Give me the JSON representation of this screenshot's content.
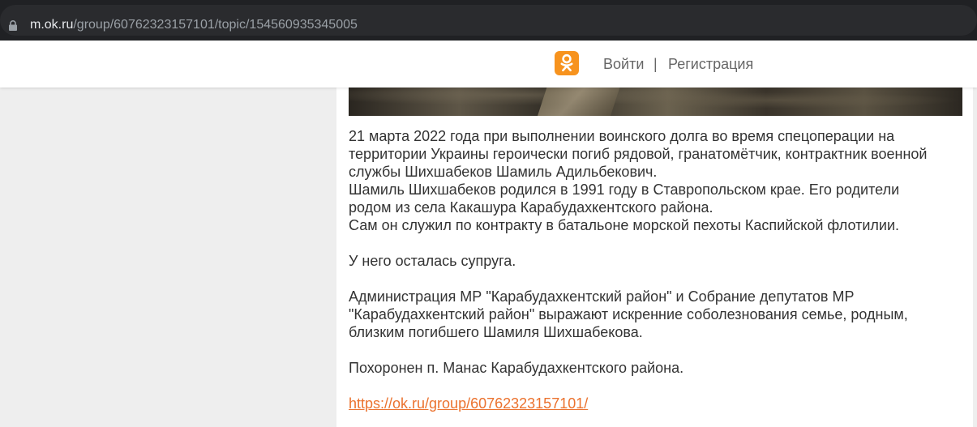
{
  "browser": {
    "url_domain": "m.ok.ru",
    "url_path": "/group/60762323157101/topic/154560935345005"
  },
  "header": {
    "login_label": "Войти",
    "separator": "|",
    "register_label": "Регистрация",
    "logo_icon": "odnoklassniki-logo-icon",
    "brand_color": "#f7931e"
  },
  "article": {
    "lines": [
      "21 марта 2022 года при выполнении воинского долга во время спецоперации на",
      "территории Украины героически погиб рядовой, гранатомётчик, контрактник военной",
      "службы Шихшабеков Шамиль Адильбекович.",
      "Шамиль Шихшабеков родился в 1991 году в Ставропольском крае. Его родители",
      "родом из села Какашура Карабудахкентского района.",
      "Сам он служил по контракту в батальоне морской пехоты Каспийской флотилии.",
      "",
      "У него осталась супруга.",
      "",
      "Администрация МР \"Карабудахкентский район\" и Собрание депутатов МР",
      "\"Карабудахкентский район\" выражают искренние соболезнования семье, родным,",
      "близким погибшего Шамиля Шихшабекова.",
      "",
      "Похоронен п. Манас Карабудахкентского района.",
      ""
    ],
    "link": "https://ok.ru/group/60762323157101/",
    "link_color": "#eb722e"
  }
}
